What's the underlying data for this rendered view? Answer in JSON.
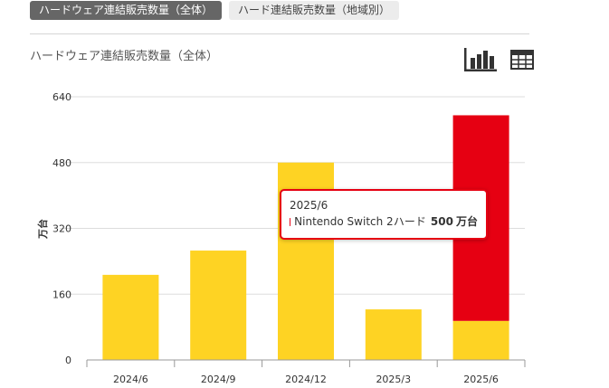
{
  "tabs": [
    {
      "label": "ハードウェア連結販売数量（全体）",
      "active": true
    },
    {
      "label": "ハード連結販売数量（地域別）",
      "active": false
    }
  ],
  "view_icons": [
    "bar-chart-icon",
    "table-icon"
  ],
  "colors": {
    "switch": "#fed323",
    "switch2": "#e60012",
    "grid": "#dddddd",
    "axis": "#999999"
  },
  "chart_data": {
    "type": "bar",
    "stacked": true,
    "title": "ハードウェア連結販売数量（全体）",
    "xlabel": "",
    "ylabel": "万台",
    "ylim": [
      0,
      640
    ],
    "yticks": [
      0,
      160,
      320,
      480,
      640
    ],
    "categories": [
      "2024/6",
      "2024/9",
      "2024/12",
      "2025/3",
      "2025/6"
    ],
    "grid": true,
    "series": [
      {
        "values": [
          207,
          266,
          480,
          123,
          95
        ],
        "color": "#fed323"
      },
      {
        "name": "Nintendo Switch 2",
        "values": [
          0,
          0,
          0,
          0,
          500
        ],
        "color": "#e60012"
      }
    ]
  },
  "tooltip": {
    "period": "2025/6",
    "series": "Nintendo Switch 2",
    "label": "ハード",
    "value": "500",
    "unit": "万台"
  }
}
